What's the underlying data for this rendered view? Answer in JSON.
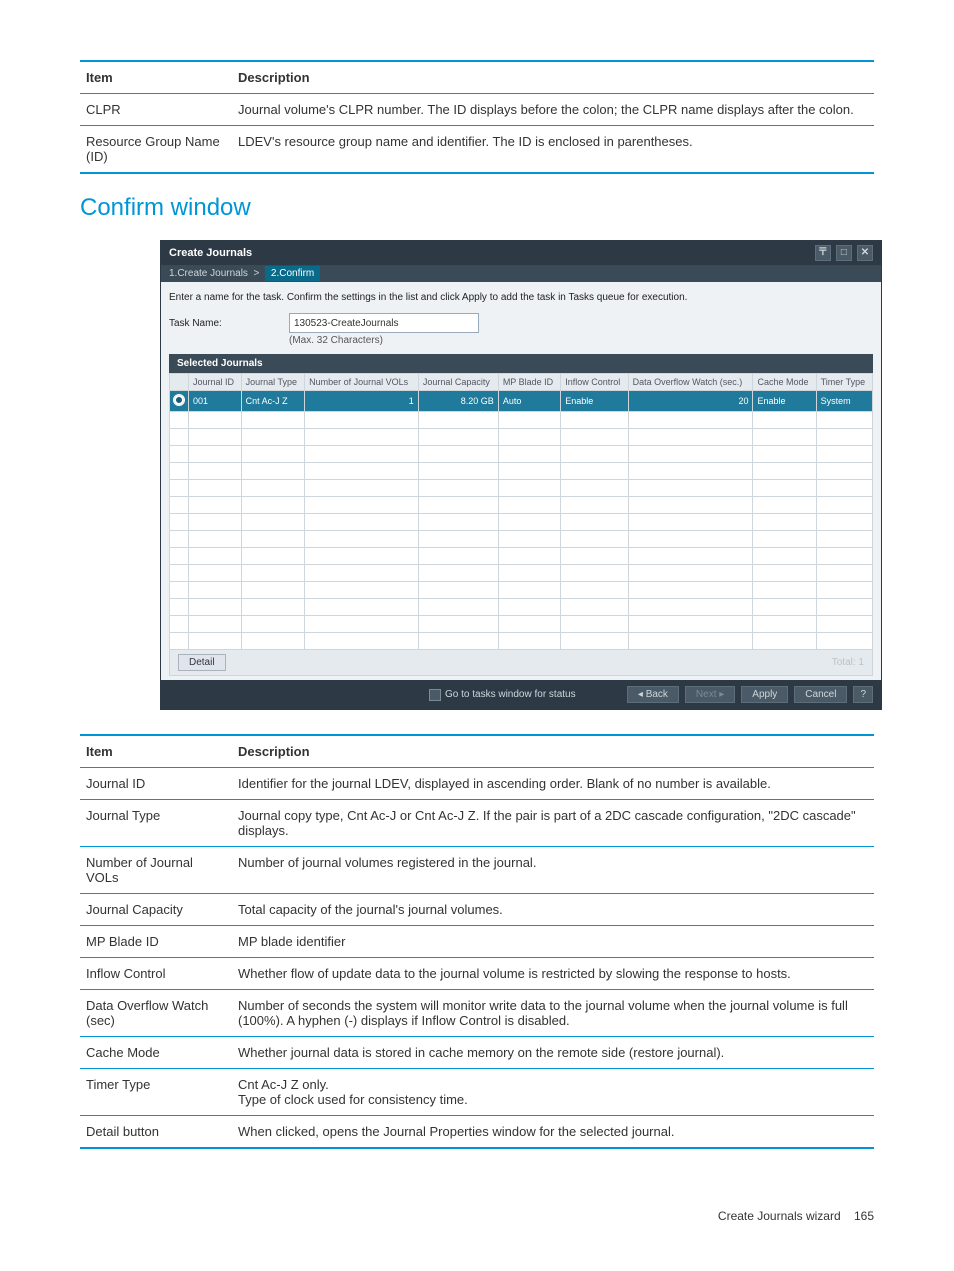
{
  "table1": {
    "header_item": "Item",
    "header_desc": "Description",
    "rows": [
      {
        "item": "CLPR",
        "desc": "Journal volume's CLPR number. The ID displays before the colon; the CLPR name displays after the colon."
      },
      {
        "item": "Resource Group Name (ID)",
        "desc": "LDEV's resource group name and identifier. The ID is enclosed in parentheses."
      }
    ]
  },
  "section_title": "Confirm window",
  "screenshot": {
    "title": "Create Journals",
    "breadcrumb_step1": "1.Create Journals",
    "breadcrumb_sep": ">",
    "breadcrumb_step2": "2.Confirm",
    "instruction": "Enter a name for the task. Confirm the settings in the list and click Apply to add the task in Tasks queue for execution.",
    "task_name_label": "Task Name:",
    "task_name_value": "130523-CreateJournals",
    "task_name_hint": "(Max. 32 Characters)",
    "subheader": "Selected Journals",
    "cols": {
      "c0": "Journal ID",
      "c1": "Journal Type",
      "c2": "Number of Journal VOLs",
      "c3": "Journal Capacity",
      "c4": "MP Blade ID",
      "c5": "Inflow Control",
      "c6": "Data Overflow Watch (sec.)",
      "c7": "Cache Mode",
      "c8": "Timer Type"
    },
    "row": {
      "c0": "001",
      "c1": "Cnt Ac-J Z",
      "c2": "1",
      "c3": "8.20 GB",
      "c4": "Auto",
      "c5": "Enable",
      "c6": "20",
      "c7": "Enable",
      "c8": "System"
    },
    "detail_btn": "Detail",
    "total_label": "Total:  1",
    "goto_label": "Go to tasks window for status",
    "back_btn": "◂ Back",
    "next_btn": "Next ▸",
    "apply_btn": "Apply",
    "cancel_btn": "Cancel",
    "help_btn": "?"
  },
  "table2": {
    "header_item": "Item",
    "header_desc": "Description",
    "rows": [
      {
        "item": "Journal ID",
        "desc": "Identifier for the journal LDEV, displayed in ascending order. Blank of no number is available."
      },
      {
        "item": "Journal Type",
        "desc": "Journal copy type, Cnt Ac-J or Cnt Ac-J Z. If the pair is part of a 2DC cascade configuration, \"2DC cascade\" displays."
      },
      {
        "item": "Number of Journal VOLs",
        "desc": "Number of journal volumes registered in the journal."
      },
      {
        "item": "Journal Capacity",
        "desc": "Total capacity of the journal's journal volumes."
      },
      {
        "item": "MP Blade ID",
        "desc": "MP blade identifier"
      },
      {
        "item": "Inflow Control",
        "desc": "Whether flow of update data to the journal volume is restricted by slowing the response to hosts."
      },
      {
        "item": "Data Overflow Watch (sec)",
        "desc": "Number of seconds the system will monitor write data to the journal volume when the journal volume is full (100%). A hyphen (-) displays if Inflow Control is disabled."
      },
      {
        "item": "Cache Mode",
        "desc": "Whether journal data is stored in cache memory on the remote side (restore journal)."
      },
      {
        "item": "Timer Type",
        "desc": "Cnt Ac-J Z only.\nType of clock used for consistency time."
      },
      {
        "item": "Detail button",
        "desc": "When clicked, opens the Journal Properties window for the selected journal."
      }
    ]
  },
  "footer": {
    "text": "Create Journals wizard",
    "page": "165"
  }
}
